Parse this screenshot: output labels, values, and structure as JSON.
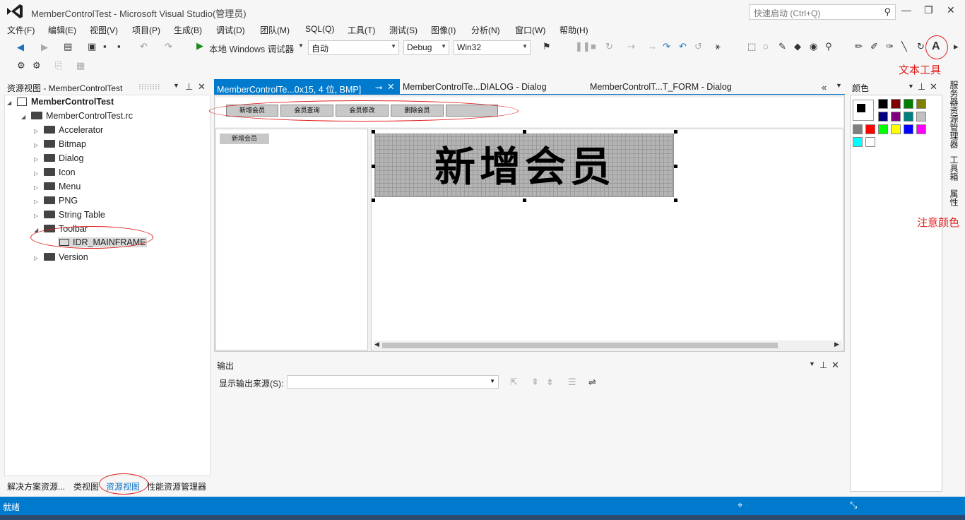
{
  "window": {
    "title": "MemberControlTest - Microsoft Visual Studio(管理员)",
    "quick_launch_placeholder": "快速启动 (Ctrl+Q)"
  },
  "menu": [
    "文件(F)",
    "编辑(E)",
    "视图(V)",
    "项目(P)",
    "生成(B)",
    "调试(D)",
    "团队(M)",
    "SQL(Q)",
    "工具(T)",
    "测试(S)",
    "图像(I)",
    "分析(N)",
    "窗口(W)",
    "帮助(H)"
  ],
  "toolbar": {
    "debugger_label": "本地 Windows 调试器",
    "mode_value": "自动",
    "config_value": "Debug",
    "platform_value": "Win32"
  },
  "left_panel": {
    "title": "资源视图 - MemberControlTest",
    "root": "MemberControlTest",
    "rc_file": "MemberControlTest.rc",
    "folders": [
      "Accelerator",
      "Bitmap",
      "Dialog",
      "Icon",
      "Menu",
      "PNG",
      "String Table",
      "Toolbar"
    ],
    "selected_item": "IDR_MAINFRAME",
    "last_folder": "Version",
    "bottom_tabs": [
      "解决方案资源...",
      "类视图",
      "资源视图",
      "性能资源管理器"
    ]
  },
  "doc_tabs": [
    "MemberControlTe...0x15, 4 位, BMP]",
    "MemberControlTe...DIALOG - Dialog",
    "MemberControlT...T_FORM - Dialog"
  ],
  "toolbar_buttons": [
    "新增会员",
    "会员查询",
    "会员修改",
    "删除会员"
  ],
  "preview_button": "新增会员",
  "edit_text": "新增会员",
  "output": {
    "title": "输出",
    "source_label": "显示输出来源(S):"
  },
  "color_panel": {
    "title": "颜色",
    "colors": [
      "#000000",
      "#800000",
      "#008000",
      "#808000",
      "#000080",
      "#800080",
      "#008080",
      "#c0c0c0",
      "#808080",
      "#ff0000",
      "#00ff00",
      "#ffff00",
      "#0000ff",
      "#ff00ff",
      "#00ffff",
      "#ffffff"
    ]
  },
  "side_tabs": [
    "服务器资源管理器",
    "工具箱",
    "属性"
  ],
  "annotations": {
    "text_tool": "文本工具",
    "note_color": "注意颜色",
    "text_tool_icon_label": "A"
  },
  "status": {
    "text": "就绪"
  }
}
